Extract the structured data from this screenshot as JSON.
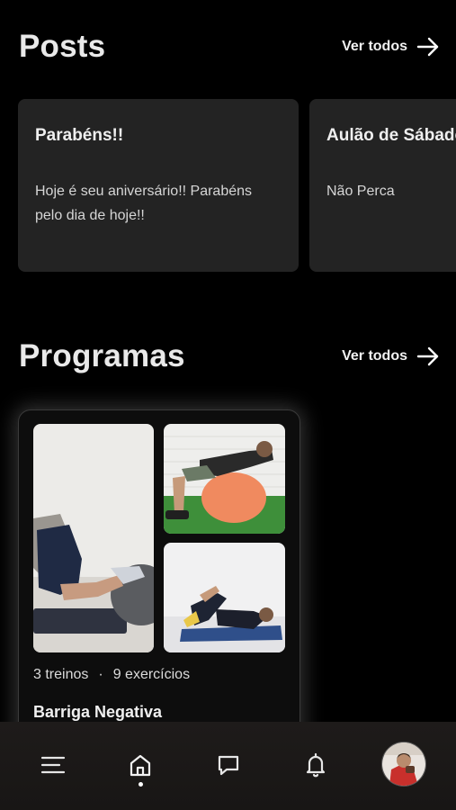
{
  "posts": {
    "title": "Posts",
    "see_all": "Ver todos",
    "items": [
      {
        "title": "Parabéns!!",
        "body": "Hoje é seu aniversário!! Parabéns pelo dia de hoje!!"
      },
      {
        "title": "Aulão de Sábado",
        "body": "Não Perca"
      }
    ]
  },
  "programs": {
    "title": "Programas",
    "see_all": "Ver todos",
    "items": [
      {
        "workouts": "3 treinos",
        "separator": "·",
        "exercises": "9 exercícios",
        "name": "Barriga Negativa"
      }
    ]
  },
  "nav": {
    "items": [
      "menu-icon",
      "home-icon",
      "chat-icon",
      "bell-icon",
      "avatar"
    ],
    "active": "home-icon"
  }
}
